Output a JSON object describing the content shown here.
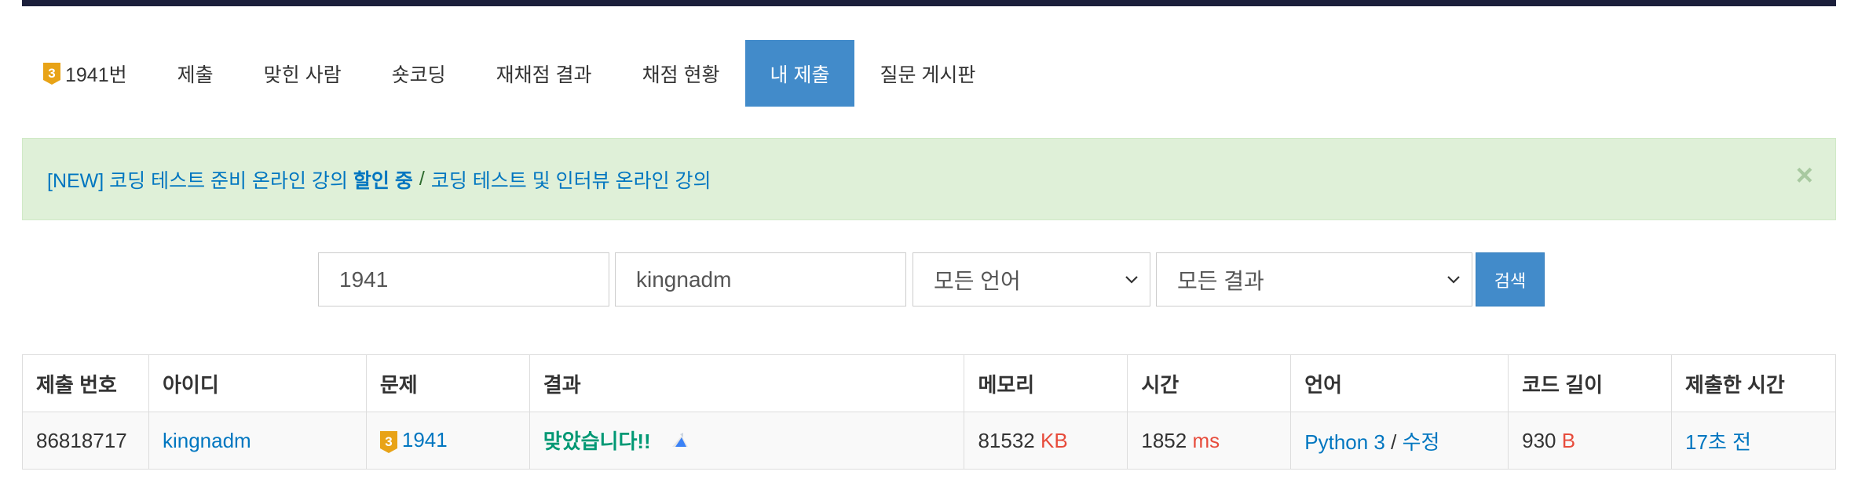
{
  "tabs": [
    {
      "label": "1941번",
      "active": false,
      "tier": "3"
    },
    {
      "label": "제출",
      "active": false
    },
    {
      "label": "맞힌 사람",
      "active": false
    },
    {
      "label": "숏코딩",
      "active": false
    },
    {
      "label": "재채점 결과",
      "active": false
    },
    {
      "label": "채점 현황",
      "active": false
    },
    {
      "label": "내 제출",
      "active": true
    },
    {
      "label": "질문 게시판",
      "active": false
    }
  ],
  "alert": {
    "part1": "[NEW] 코딩 테스트 준비 온라인 강의",
    "part2": "할인 중",
    "separator": "/",
    "part3": "코딩 테스트 및 인터뷰 온라인 강의",
    "close": "×"
  },
  "search": {
    "problem_value": "1941",
    "user_value": "kingnadm",
    "language_selected": "모든 언어",
    "result_selected": "모든 결과",
    "button_label": "검색"
  },
  "table": {
    "headers": [
      "제출 번호",
      "아이디",
      "문제",
      "결과",
      "메모리",
      "시간",
      "언어",
      "코드 길이",
      "제출한 시간"
    ],
    "row": {
      "submission_id": "86818717",
      "user": "kingnadm",
      "problem_tier": "3",
      "problem": "1941",
      "result": "맞았습니다!!",
      "memory": "81532",
      "memory_unit": "KB",
      "time": "1852",
      "time_unit": "ms",
      "language": "Python 3",
      "lang_sep": "/",
      "edit": "수정",
      "code_length": "930",
      "code_unit": "B",
      "submitted": "17초 전"
    }
  },
  "colors": {
    "accent": "#428bca",
    "link": "#0076c0",
    "accepted": "#009874",
    "unit": "#e74c3c",
    "tier_gold": "#e8a317"
  },
  "icons": {
    "tier": "gold-tier-3-icon",
    "share": "share-triangle-icon",
    "close": "close-icon",
    "chevron": "chevron-down-icon"
  }
}
